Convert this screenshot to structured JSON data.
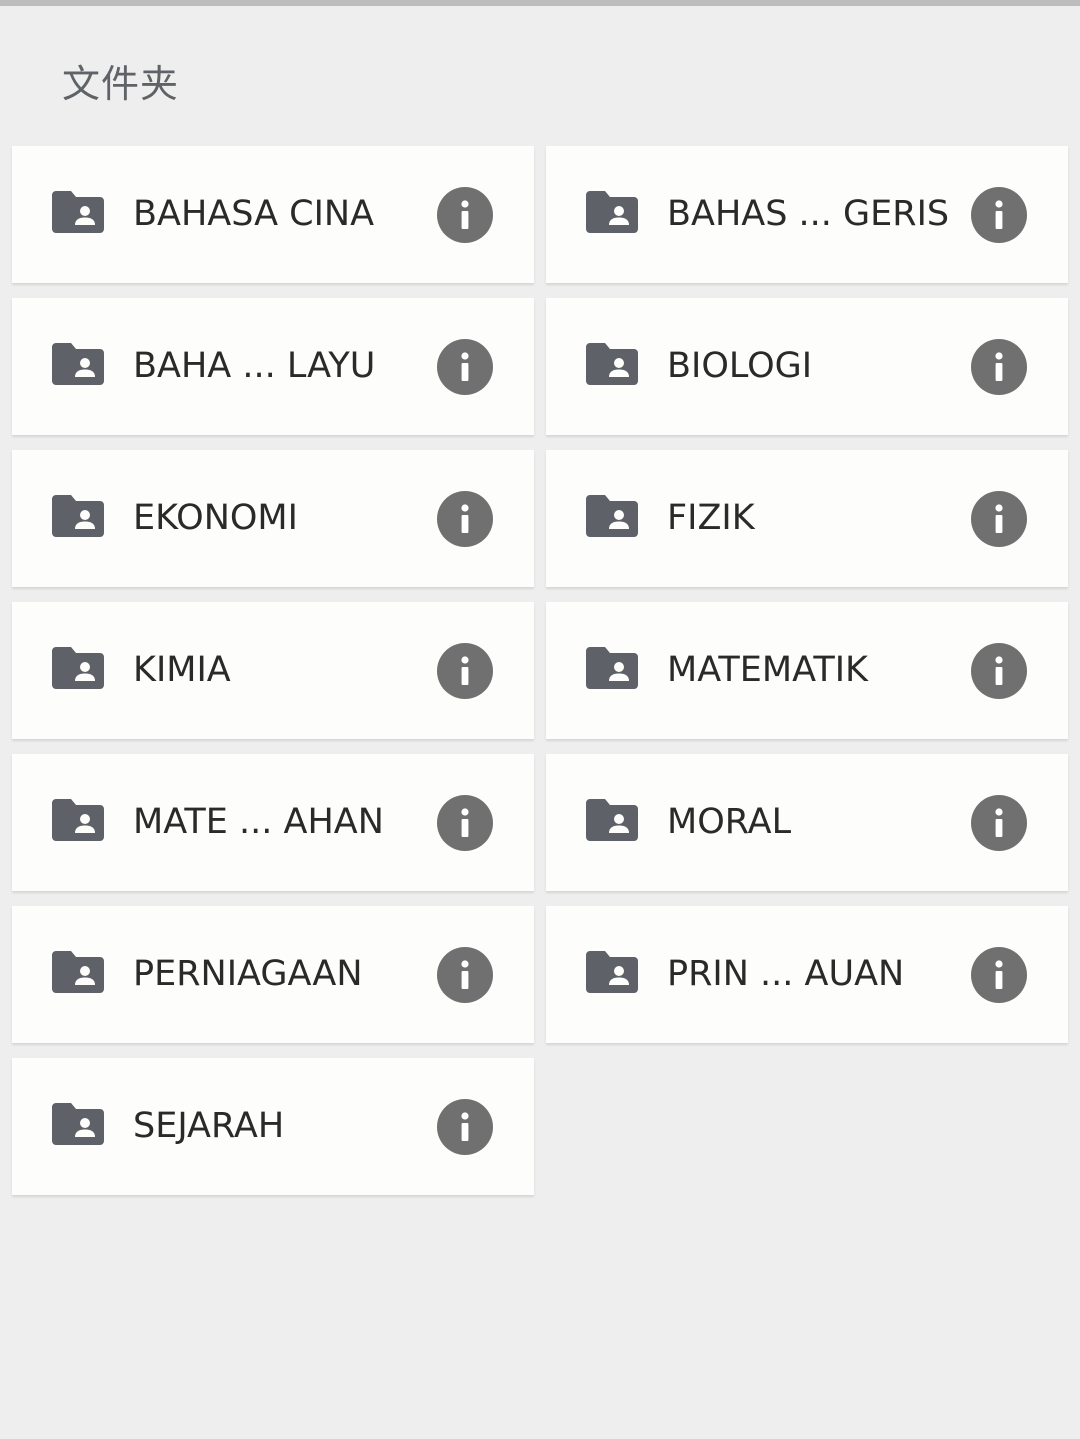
{
  "header": {
    "title": "文件夹"
  },
  "folders": [
    {
      "label": "BAHASA CINA"
    },
    {
      "label": "BAHAS ... GERIS"
    },
    {
      "label": "BAHA ... LAYU"
    },
    {
      "label": "BIOLOGI"
    },
    {
      "label": "EKONOMI"
    },
    {
      "label": "FIZIK"
    },
    {
      "label": "KIMIA"
    },
    {
      "label": "MATEMATIK"
    },
    {
      "label": "MATE ... AHAN"
    },
    {
      "label": "MORAL"
    },
    {
      "label": "PERNIAGAAN"
    },
    {
      "label": "PRIN ... AUAN"
    },
    {
      "label": "SEJARAH"
    }
  ],
  "icons": {
    "folder": "shared-folder-icon",
    "info": "info-icon"
  },
  "colors": {
    "background": "#eeeeee",
    "card": "#fdfdfb",
    "icon": "#5f6168",
    "info_button": "#707070",
    "text": "#2a2a2a"
  }
}
